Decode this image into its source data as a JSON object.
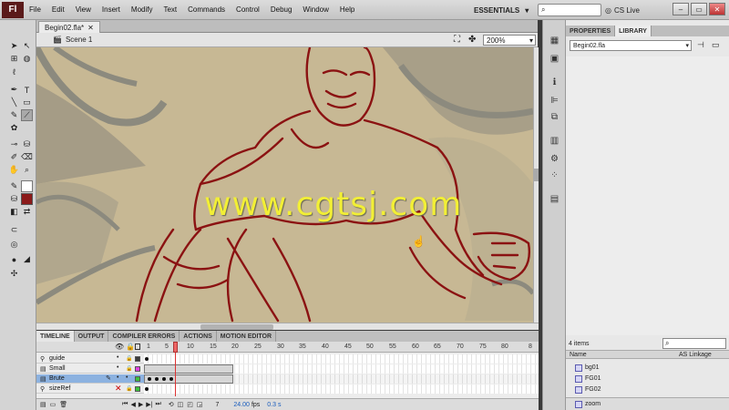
{
  "menubar": {
    "items": [
      "File",
      "Edit",
      "View",
      "Insert",
      "Modify",
      "Text",
      "Commands",
      "Control",
      "Debug",
      "Window",
      "Help"
    ],
    "workspace": "ESSENTIALS",
    "cs_live": "CS Live"
  },
  "document": {
    "tab": "Begin02.fla*",
    "scene": "Scene 1",
    "zoom": "200%"
  },
  "watermark": "www.cgtsj.com",
  "timeline": {
    "tabs": [
      "TIMELINE",
      "OUTPUT",
      "COMPILER ERRORS",
      "ACTIONS",
      "MOTION EDITOR"
    ],
    "frame_numbers": [
      "1",
      "5",
      "10",
      "15",
      "20",
      "25",
      "30",
      "35",
      "40",
      "45",
      "50",
      "55",
      "60",
      "65",
      "70",
      "75",
      "80",
      "8"
    ],
    "layers": [
      {
        "name": "guide",
        "color": "#3c3c3c"
      },
      {
        "name": "Small",
        "color": "#e040e0"
      },
      {
        "name": "Brute",
        "color": "#3dc23d"
      },
      {
        "name": "sizeRef",
        "color": "#3dc23d"
      }
    ],
    "current_frame": "7",
    "fps": "24.00",
    "fps_unit": "fps",
    "elapsed": "0.3 s"
  },
  "panels": {
    "tabs": [
      "PROPERTIES",
      "LIBRARY"
    ],
    "library_file": "Begin02.fla",
    "item_count": "4 items",
    "col_name": "Name",
    "col_linkage": "AS Linkage",
    "items": [
      "bg01",
      "FG01",
      "FG02",
      "zoom"
    ]
  }
}
